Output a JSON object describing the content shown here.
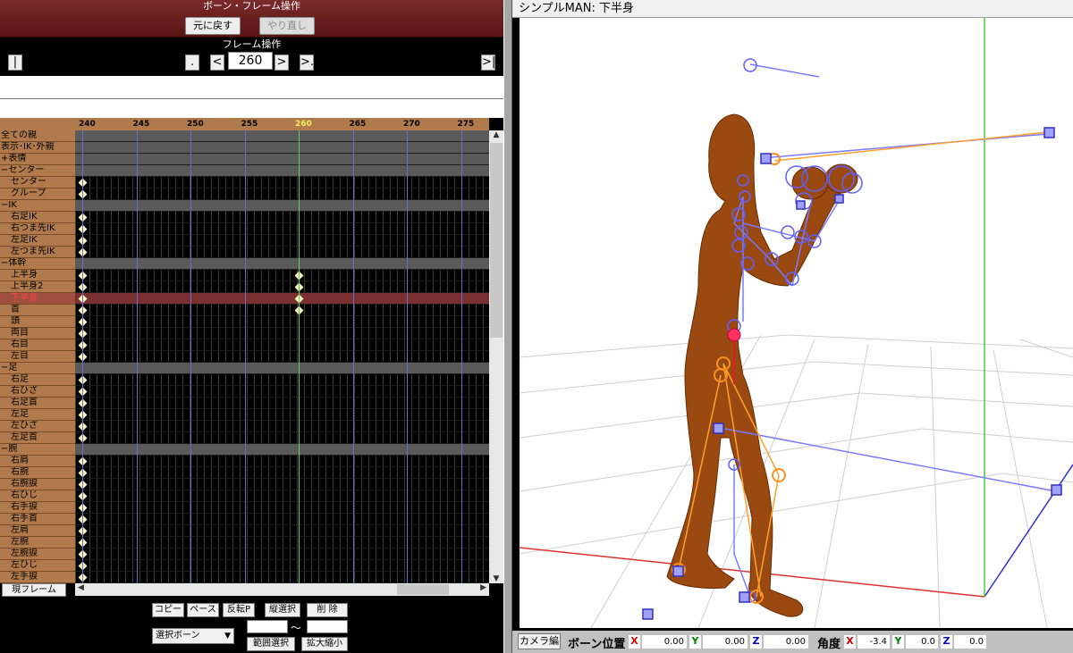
{
  "bone_panel": {
    "title": "ボーン・フレーム操作",
    "undo": "元に戻す",
    "redo": "やり直し"
  },
  "frame_panel": {
    "title": "フレーム操作",
    "first": "|<",
    "prev_key": ".<",
    "prev": "<",
    "current": "260",
    "next": ">",
    "next_key": ">.",
    "last": ">|"
  },
  "timeline": {
    "ticks": [
      "240",
      "245",
      "250",
      "255",
      "260",
      "265",
      "270",
      "275"
    ],
    "bones": [
      "全ての親",
      "表示･IK･外親",
      "+表情",
      "−センター",
      "センター",
      "グループ",
      "−IK",
      "右足IK",
      "右つま先IK",
      "左足IK",
      "左つま先IK",
      "−体幹",
      "上半身",
      "上半身2",
      "下半身",
      "首",
      "頭",
      "両目",
      "右目",
      "左目",
      "−足",
      "右足",
      "右ひざ",
      "右足首",
      "左足",
      "左ひざ",
      "左足首",
      "−腕",
      "右肩",
      "右腕",
      "右腕捩",
      "右ひじ",
      "右手捩",
      "右手首",
      "左肩",
      "左腕",
      "左腕捩",
      "左ひじ",
      "左手捩"
    ]
  },
  "bottom": {
    "current_frame_btn": "現フレーム",
    "copy": "コピー",
    "paste": "ペースト",
    "flip_paste": "反転P",
    "vertical_select": "縦選択",
    "delete": "削 除",
    "range_sep": "〜",
    "select_dropdown": "選択ボーン",
    "range_select": "範囲選択",
    "zoom": "拡大縮小"
  },
  "viewport": {
    "title": "シンプルMAN: 下半身"
  },
  "status": {
    "camera_btn": "カメラ編",
    "bone_pos_label": "ボーン位置",
    "pos_x": "0.00",
    "pos_y": "0.00",
    "pos_z": "0.00",
    "angle_label": "角度",
    "ang_x": "-3.4",
    "ang_y": "0.0",
    "ang_z": "0.0",
    "x": "X",
    "y": "Y",
    "z": "Z"
  }
}
